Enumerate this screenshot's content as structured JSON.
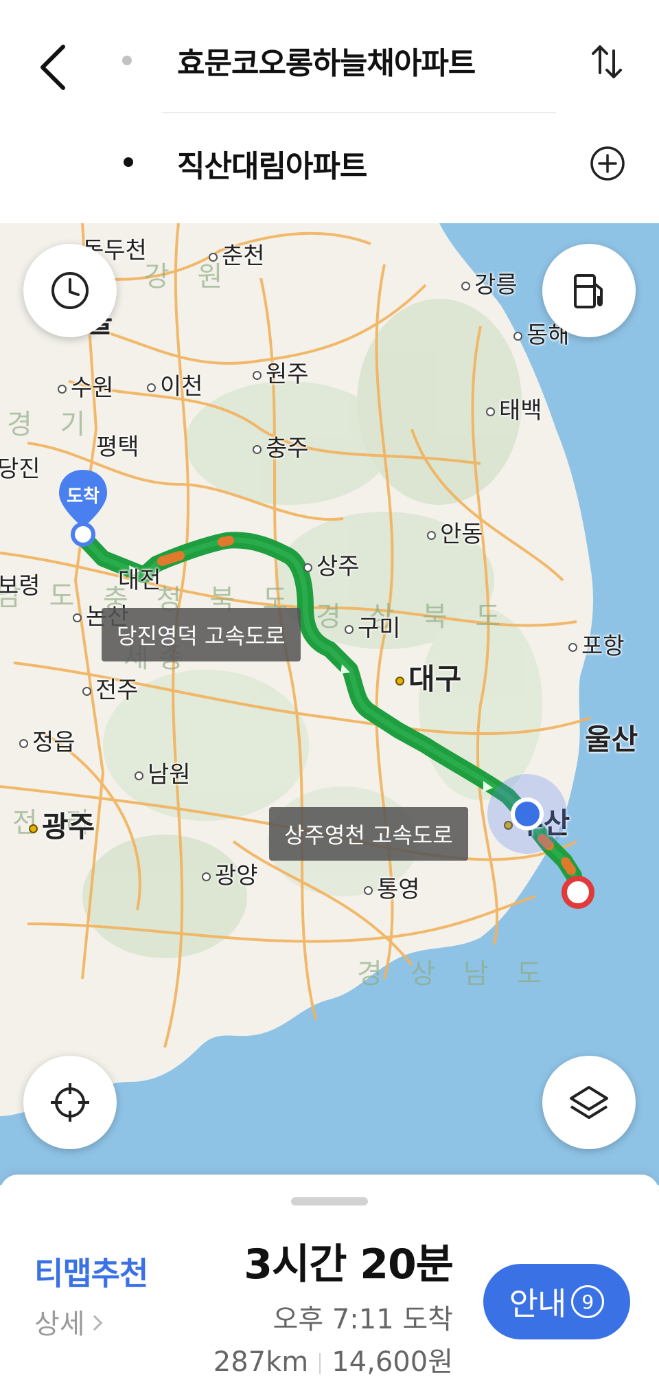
{
  "header": {
    "start_place": "효문코오롱하늘채아파트",
    "end_place": "직산대림아파트"
  },
  "map": {
    "cities": [
      {
        "name": "동두천",
        "big": false,
        "dot": "none"
      },
      {
        "name": "춘천",
        "big": false,
        "dot": "plain"
      },
      {
        "name": "강릉",
        "big": false,
        "dot": "plain"
      },
      {
        "name": "서울",
        "big": true,
        "dot": "gold"
      },
      {
        "name": "동해",
        "big": false,
        "dot": "plain"
      },
      {
        "name": "원주",
        "big": false,
        "dot": "plain"
      },
      {
        "name": "수원",
        "big": false,
        "dot": "plain"
      },
      {
        "name": "이천",
        "big": false,
        "dot": "plain"
      },
      {
        "name": "태백",
        "big": false,
        "dot": "plain"
      },
      {
        "name": "평택",
        "big": false,
        "dot": "none"
      },
      {
        "name": "충주",
        "big": false,
        "dot": "plain"
      },
      {
        "name": "당진",
        "big": false,
        "dot": "none"
      },
      {
        "name": "안동",
        "big": false,
        "dot": "plain"
      },
      {
        "name": "상주",
        "big": false,
        "dot": "plain"
      },
      {
        "name": "보령",
        "big": false,
        "dot": "none"
      },
      {
        "name": "대전",
        "big": false,
        "dot": "none"
      },
      {
        "name": "논산",
        "big": false,
        "dot": "plain"
      },
      {
        "name": "구미",
        "big": false,
        "dot": "plain"
      },
      {
        "name": "포항",
        "big": false,
        "dot": "plain"
      },
      {
        "name": "전주",
        "big": false,
        "dot": "plain"
      },
      {
        "name": "대구",
        "big": true,
        "dot": "gold"
      },
      {
        "name": "정읍",
        "big": false,
        "dot": "plain"
      },
      {
        "name": "울산",
        "big": true,
        "dot": "none"
      },
      {
        "name": "남원",
        "big": false,
        "dot": "plain"
      },
      {
        "name": "광주",
        "big": true,
        "dot": "gold"
      },
      {
        "name": "부산",
        "big": true,
        "dot": "gold"
      },
      {
        "name": "광양",
        "big": false,
        "dot": "plain"
      },
      {
        "name": "통영",
        "big": false,
        "dot": "plain"
      }
    ],
    "regions": [
      "강 원",
      "경 기",
      "충 청 북 도",
      "남 도",
      "경 상 북 도",
      "세종",
      "전 라",
      "경 상 남 도"
    ],
    "road_labels": [
      "당진영덕 고속도로",
      "상주영천 고속도로"
    ],
    "destination_marker_label": "도착",
    "route_color": "#1e9e3e",
    "sea_color": "#8fc3e6",
    "icons": {
      "history": "clock-icon",
      "fuel": "gas-station-icon",
      "locate": "crosshair-icon",
      "layers": "layers-icon"
    }
  },
  "sheet": {
    "recommend_label": "티맵추천",
    "detail_label": "상세",
    "duration": "3시간 20분",
    "arrival": "오후 7:11 도착",
    "distance": "287km",
    "toll": "14,600원",
    "nav_label": "안내",
    "nav_count": "9",
    "accent_color": "#3a72e6"
  }
}
